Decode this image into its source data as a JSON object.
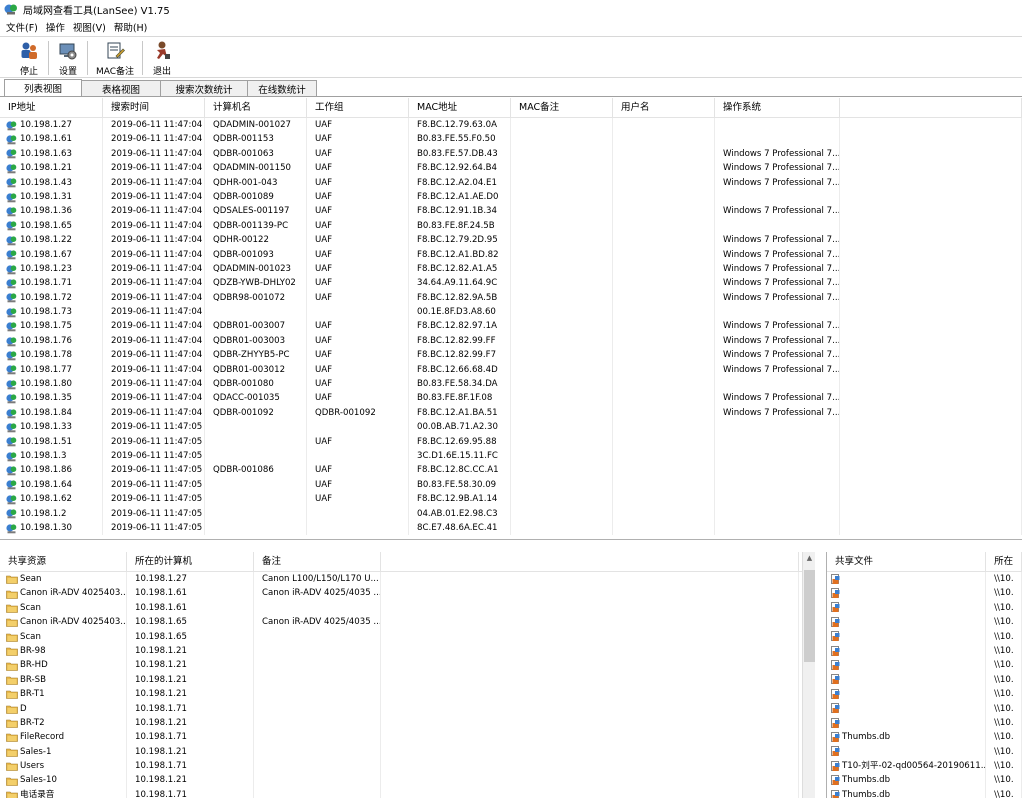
{
  "window": {
    "title": "局域网查看工具(LanSee) V1.75"
  },
  "menu": [
    "文件(F)",
    "操作",
    "视图(V)",
    "帮助(H)"
  ],
  "toolbar": {
    "stop": "停止",
    "settings": "设置",
    "mac_note": "MAC备注",
    "exit": "退出"
  },
  "tabs": [
    "列表视图",
    "表格视图",
    "搜索次数统计",
    "在线数统计"
  ],
  "main": {
    "columns": [
      "IP地址",
      "搜索时间",
      "计算机名",
      "工作组",
      "MAC地址",
      "MAC备注",
      "用户名",
      "操作系统",
      ""
    ],
    "rows": [
      [
        "10.198.1.27",
        "2019-06-11 11:47:04",
        "QDADMIN-001027",
        "UAF",
        "F8.BC.12.79.63.0A",
        "",
        "",
        ""
      ],
      [
        "10.198.1.61",
        "2019-06-11 11:47:04",
        "QDBR-001153",
        "UAF",
        "B0.83.FE.55.F0.50",
        "",
        "",
        ""
      ],
      [
        "10.198.1.63",
        "2019-06-11 11:47:04",
        "QDBR-001063",
        "UAF",
        "B0.83.FE.57.DB.43",
        "",
        "",
        "Windows 7 Professional 7..."
      ],
      [
        "10.198.1.21",
        "2019-06-11 11:47:04",
        "QDADMIN-001150",
        "UAF",
        "F8.BC.12.92.64.B4",
        "",
        "",
        "Windows 7 Professional 7..."
      ],
      [
        "10.198.1.43",
        "2019-06-11 11:47:04",
        "QDHR-001-043",
        "UAF",
        "F8.BC.12.A2.04.E1",
        "",
        "",
        "Windows 7 Professional 7..."
      ],
      [
        "10.198.1.31",
        "2019-06-11 11:47:04",
        "QDBR-001089",
        "UAF",
        "F8.BC.12.A1.AE.D0",
        "",
        "",
        ""
      ],
      [
        "10.198.1.36",
        "2019-06-11 11:47:04",
        "QDSALES-001197",
        "UAF",
        "F8.BC.12.91.1B.34",
        "",
        "",
        "Windows 7 Professional 7..."
      ],
      [
        "10.198.1.65",
        "2019-06-11 11:47:04",
        "QDBR-001139-PC",
        "UAF",
        "B0.83.FE.8F.24.5B",
        "",
        "",
        ""
      ],
      [
        "10.198.1.22",
        "2019-06-11 11:47:04",
        "QDHR-00122",
        "UAF",
        "F8.BC.12.79.2D.95",
        "",
        "",
        "Windows 7 Professional 7..."
      ],
      [
        "10.198.1.67",
        "2019-06-11 11:47:04",
        "QDBR-001093",
        "UAF",
        "F8.BC.12.A1.BD.82",
        "",
        "",
        "Windows 7 Professional 7..."
      ],
      [
        "10.198.1.23",
        "2019-06-11 11:47:04",
        "QDADMIN-001023",
        "UAF",
        "F8.BC.12.82.A1.A5",
        "",
        "",
        "Windows 7 Professional 7..."
      ],
      [
        "10.198.1.71",
        "2019-06-11 11:47:04",
        "QDZB-YWB-DHLY02",
        "UAF",
        "34.64.A9.11.64.9C",
        "",
        "",
        "Windows 7 Professional 7..."
      ],
      [
        "10.198.1.72",
        "2019-06-11 11:47:04",
        "QDBR98-001072",
        "UAF",
        "F8.BC.12.82.9A.5B",
        "",
        "",
        "Windows 7 Professional 7..."
      ],
      [
        "10.198.1.73",
        "2019-06-11 11:47:04",
        "",
        "",
        "00.1E.8F.D3.A8.60",
        "",
        "",
        ""
      ],
      [
        "10.198.1.75",
        "2019-06-11 11:47:04",
        "QDBR01-003007",
        "UAF",
        "F8.BC.12.82.97.1A",
        "",
        "",
        "Windows 7 Professional 7..."
      ],
      [
        "10.198.1.76",
        "2019-06-11 11:47:04",
        "QDBR01-003003",
        "UAF",
        "F8.BC.12.82.99.FF",
        "",
        "",
        "Windows 7 Professional 7..."
      ],
      [
        "10.198.1.78",
        "2019-06-11 11:47:04",
        "QDBR-ZHYYB5-PC",
        "UAF",
        "F8.BC.12.82.99.F7",
        "",
        "",
        "Windows 7 Professional 7..."
      ],
      [
        "10.198.1.77",
        "2019-06-11 11:47:04",
        "QDBR01-003012",
        "UAF",
        "F8.BC.12.66.68.4D",
        "",
        "",
        "Windows 7 Professional 7..."
      ],
      [
        "10.198.1.80",
        "2019-06-11 11:47:04",
        "QDBR-001080",
        "UAF",
        "B0.83.FE.58.34.DA",
        "",
        "",
        ""
      ],
      [
        "10.198.1.35",
        "2019-06-11 11:47:04",
        "QDACC-001035",
        "UAF",
        "B0.83.FE.8F.1F.08",
        "",
        "",
        "Windows 7 Professional 7..."
      ],
      [
        "10.198.1.84",
        "2019-06-11 11:47:04",
        "QDBR-001092",
        "QDBR-001092",
        "F8.BC.12.A1.BA.51",
        "",
        "",
        "Windows 7 Professional 7..."
      ],
      [
        "10.198.1.33",
        "2019-06-11 11:47:05",
        "",
        "",
        "00.0B.AB.71.A2.30",
        "",
        "",
        ""
      ],
      [
        "10.198.1.51",
        "2019-06-11 11:47:05",
        "",
        "UAF",
        "F8.BC.12.69.95.88",
        "",
        "",
        ""
      ],
      [
        "10.198.1.3",
        "2019-06-11 11:47:05",
        "",
        "",
        "3C.D1.6E.15.11.FC",
        "",
        "",
        ""
      ],
      [
        "10.198.1.86",
        "2019-06-11 11:47:05",
        "QDBR-001086",
        "UAF",
        "F8.BC.12.8C.CC.A1",
        "",
        "",
        ""
      ],
      [
        "10.198.1.64",
        "2019-06-11 11:47:05",
        "",
        "UAF",
        "B0.83.FE.58.30.09",
        "",
        "",
        ""
      ],
      [
        "10.198.1.62",
        "2019-06-11 11:47:05",
        "",
        "UAF",
        "F8.BC.12.9B.A1.14",
        "",
        "",
        ""
      ],
      [
        "10.198.1.2",
        "2019-06-11 11:47:05",
        "",
        "",
        "04.AB.01.E2.98.C3",
        "",
        "",
        ""
      ],
      [
        "10.198.1.30",
        "2019-06-11 11:47:05",
        "",
        "",
        "8C.E7.48.6A.EC.41",
        "",
        "",
        ""
      ]
    ]
  },
  "shares": {
    "columns": [
      "共享资源",
      "所在的计算机",
      "备注",
      ""
    ],
    "rows": [
      [
        "Sean",
        "10.198.1.27",
        "Canon L100/L150/L170 U..."
      ],
      [
        "Canon iR-ADV 4025403...",
        "10.198.1.61",
        "Canon iR-ADV 4025/4035 ..."
      ],
      [
        "Scan",
        "10.198.1.61",
        ""
      ],
      [
        "Canon iR-ADV 4025403...",
        "10.198.1.65",
        "Canon iR-ADV 4025/4035 ..."
      ],
      [
        "Scan",
        "10.198.1.65",
        ""
      ],
      [
        "BR-98",
        "10.198.1.21",
        ""
      ],
      [
        "BR-HD",
        "10.198.1.21",
        ""
      ],
      [
        "BR-SB",
        "10.198.1.21",
        ""
      ],
      [
        "BR-T1",
        "10.198.1.21",
        ""
      ],
      [
        "D",
        "10.198.1.71",
        ""
      ],
      [
        "BR-T2",
        "10.198.1.21",
        ""
      ],
      [
        "FileRecord",
        "10.198.1.71",
        ""
      ],
      [
        "Sales-1",
        "10.198.1.21",
        ""
      ],
      [
        "Users",
        "10.198.1.71",
        ""
      ],
      [
        "Sales-10",
        "10.198.1.21",
        ""
      ],
      [
        "电话录音",
        "10.198.1.71",
        ""
      ]
    ]
  },
  "shared_files": {
    "columns": [
      "共享文件",
      "所在"
    ],
    "rows": [
      [
        "",
        "\\\\10."
      ],
      [
        "",
        "\\\\10."
      ],
      [
        "",
        "\\\\10."
      ],
      [
        "",
        "\\\\10."
      ],
      [
        "",
        "\\\\10."
      ],
      [
        "",
        "\\\\10."
      ],
      [
        "",
        "\\\\10."
      ],
      [
        "",
        "\\\\10."
      ],
      [
        "",
        "\\\\10."
      ],
      [
        "",
        "\\\\10."
      ],
      [
        "",
        "\\\\10."
      ],
      [
        "Thumbs.db",
        "\\\\10."
      ],
      [
        "",
        "\\\\10."
      ],
      [
        "T10-刘平-02-qd00564-20190611...",
        "\\\\10."
      ],
      [
        "Thumbs.db",
        "\\\\10."
      ],
      [
        "Thumbs.db",
        "\\\\10."
      ]
    ]
  },
  "scrollbar": {
    "up_arrow": "▲"
  },
  "colors": {
    "folder": "#e8b84a",
    "pc_blue": "#3b7fd0",
    "pc_green": "#2aa845",
    "border": "#a0a0a0"
  }
}
